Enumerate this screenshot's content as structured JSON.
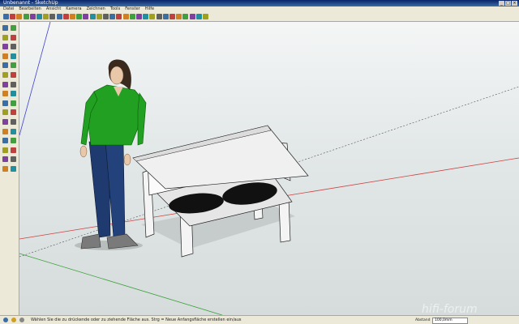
{
  "window": {
    "title": "Unbenannt - SketchUp",
    "buttons": [
      "_",
      "□",
      "×"
    ]
  },
  "menu": {
    "items": [
      "Datei",
      "Bearbeiten",
      "Ansicht",
      "Kamera",
      "Zeichnen",
      "Tools",
      "Fenster",
      "Hilfe"
    ]
  },
  "toolbar": {
    "icons": [
      "select-icon",
      "pencil-icon",
      "rectangle-icon",
      "circle-icon",
      "arc-icon",
      "polygon-icon",
      "eraser-icon",
      "paint-icon",
      "push-pull-icon",
      "follow-me-icon",
      "move-icon",
      "rotate-icon",
      "scale-icon",
      "offset-icon",
      "tape-icon",
      "dimension-icon",
      "protractor-icon",
      "text-icon",
      "axes-icon",
      "3d-text-icon",
      "orbit-icon",
      "pan-icon",
      "zoom-icon",
      "zoom-window-icon",
      "zoom-extents-icon",
      "previous-icon",
      "next-icon",
      "walk-icon",
      "look-around-icon",
      "position-camera-icon",
      "section-icon"
    ]
  },
  "status": {
    "hint": "Wählen Sie die zu drückende oder zu ziehende Fläche aus. Strg = Neue Anfangsfläche erstellen ein/aus",
    "measurement_label": "Abstand",
    "measurement_value": "100,0mm"
  },
  "watermark": "hifi-forum",
  "colors": {
    "sky": "#eef1f1",
    "ground": "#d6dcdc",
    "axis_red": "#d04040",
    "axis_green": "#3aa03a",
    "axis_blue": "#4040d0",
    "shirt": "#22a022",
    "jeans": "#1e3a6e"
  }
}
